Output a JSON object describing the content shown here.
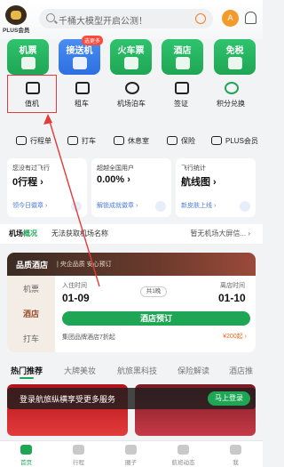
{
  "header": {
    "logo_text": "PLUS会员",
    "search_placeholder": "千桶大模型开启公测！",
    "avatar_text": "A"
  },
  "top_tiles": [
    {
      "label": "机票"
    },
    {
      "label": "接送机",
      "badge": "选更多"
    },
    {
      "label": "火车票"
    },
    {
      "label": "酒店"
    },
    {
      "label": "免税"
    }
  ],
  "services_row1": [
    {
      "label": "值机",
      "icon": "seat-icon"
    },
    {
      "label": "租车",
      "icon": "car-icon"
    },
    {
      "label": "机场泊车",
      "icon": "parking-icon"
    },
    {
      "label": "签证",
      "icon": "visa-icon"
    },
    {
      "label": "积分兑换",
      "icon": "gift-icon"
    }
  ],
  "services_row2": [
    {
      "label": "行程单",
      "icon": "receipt-icon"
    },
    {
      "label": "打车",
      "icon": "taxi-icon"
    },
    {
      "label": "休息室",
      "icon": "lounge-icon"
    },
    {
      "label": "保险",
      "icon": "shield-icon"
    },
    {
      "label": "PLUS会员",
      "icon": "crown-icon"
    }
  ],
  "stats": [
    {
      "top": "您没有过飞行",
      "main": "0行程 ›",
      "link": "领今日徽章 ›"
    },
    {
      "top": "超越全国用户",
      "main": "0.00% ›",
      "link": "解锁成就徽章 ›"
    },
    {
      "top": "飞行统计",
      "main": "航线图 ›",
      "link": "新皮肤上线 ›"
    }
  ],
  "notice": {
    "label": "机场",
    "highlight": "概况",
    "text": "无法获取机场名称",
    "right": "暂无机场大屏信... ›"
  },
  "hotel": {
    "title": "品质酒店",
    "subtitle": "| 央企品质 安心预订",
    "side_tabs": [
      "机票",
      "酒店",
      "打车"
    ],
    "checkin_label": "入住时间",
    "checkin_date": "01-09",
    "checkout_label": "离店时间",
    "checkout_date": "01-10",
    "nights": "共1晚",
    "book_button": "酒店预订",
    "promo": "集团品牌酒店7折起",
    "promo_price": "¥200起 ›"
  },
  "tabs": [
    "热门推荐",
    "大牌美妆",
    "航旅黑科技",
    "保险解读",
    "酒店推"
  ],
  "toast": {
    "text": "登录航旅纵横享受更多服务",
    "button": "马上登录"
  },
  "bottom_nav": [
    {
      "label": "首页"
    },
    {
      "label": "行程"
    },
    {
      "label": "圈子"
    },
    {
      "label": "航班动态"
    },
    {
      "label": "我"
    }
  ]
}
